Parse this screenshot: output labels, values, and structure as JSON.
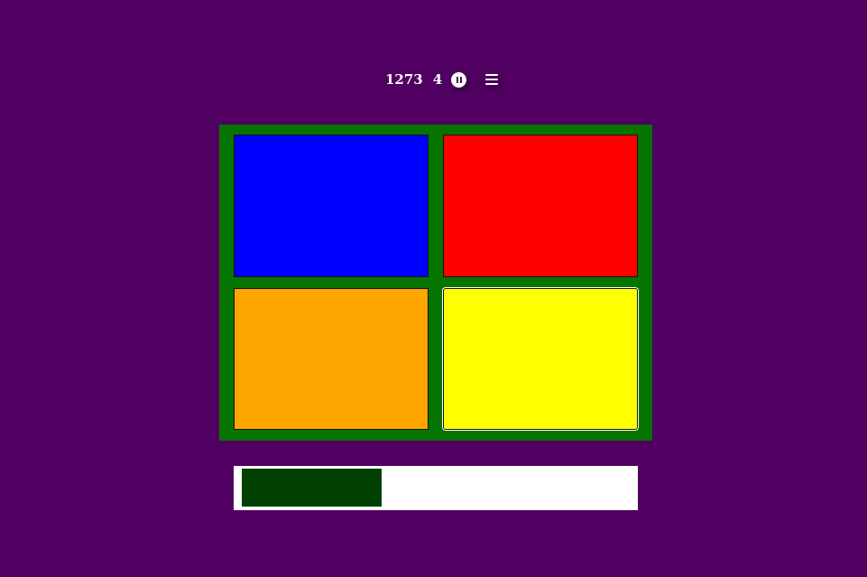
{
  "colors": {
    "background": "#500060",
    "board": "#067400",
    "progress_track": "#ffffff",
    "progress_fill": "#004000",
    "pause_bars": "#500060"
  },
  "hud": {
    "score": "1273",
    "level": "4",
    "pause_icon": "pause-icon",
    "menu_icon": "menu-icon"
  },
  "tiles": [
    {
      "color": "#0000ff",
      "selected": false
    },
    {
      "color": "#ff0000",
      "selected": false
    },
    {
      "color": "#ffa500",
      "selected": false
    },
    {
      "color": "#ffff00",
      "selected": true
    }
  ],
  "progress": {
    "value": 0.36
  }
}
